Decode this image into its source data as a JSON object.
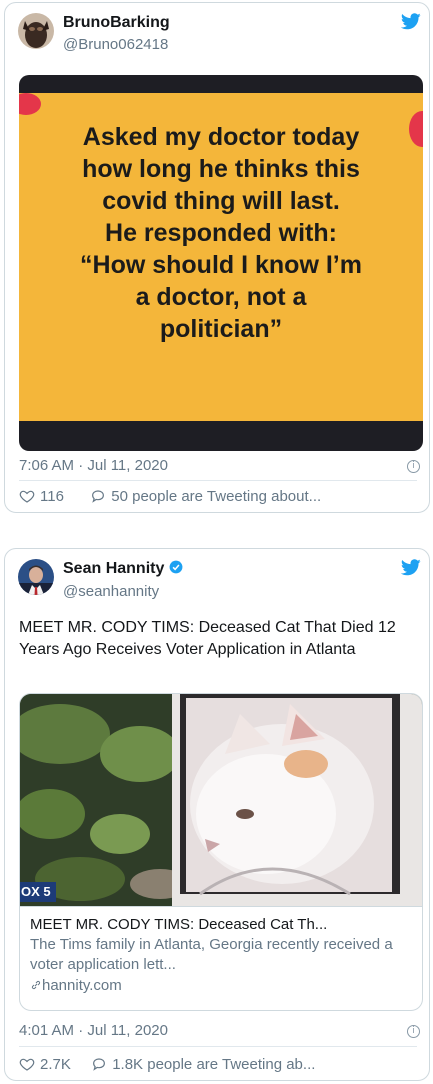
{
  "tweets": [
    {
      "author_name": "BrunoBarking",
      "handle": "@Bruno062418",
      "meme_lines": [
        "Asked my doctor today",
        "how long he thinks this",
        "covid thing will last.",
        "He responded with:",
        "“How should I know I’m",
        "a doctor, not a",
        "politician”"
      ],
      "timestamp": "7:06 AM · Jul 11, 2020",
      "likes": "116",
      "conversation": "50 people are Tweeting about..."
    },
    {
      "author_name": "Sean Hannity",
      "handle": "@seanhannity",
      "text": "MEET MR. CODY TIMS: Deceased Cat That Died 12 Years Ago Receives Voter Application in Atlanta",
      "link_card": {
        "image_badge": "OX 5",
        "title": "MEET MR. CODY TIMS: Deceased Cat Th...",
        "description": "The Tims family in Atlanta, Georgia recently received a voter application lett...",
        "domain": "hannity.com"
      },
      "timestamp": "4:01 AM · Jul 11, 2020",
      "likes": "2.7K",
      "conversation": "1.8K people are Tweeting ab..."
    }
  ],
  "colors": {
    "twitter_blue": "#1da1f2",
    "meme_yellow": "#f4b63a",
    "muted_text": "#657786"
  }
}
